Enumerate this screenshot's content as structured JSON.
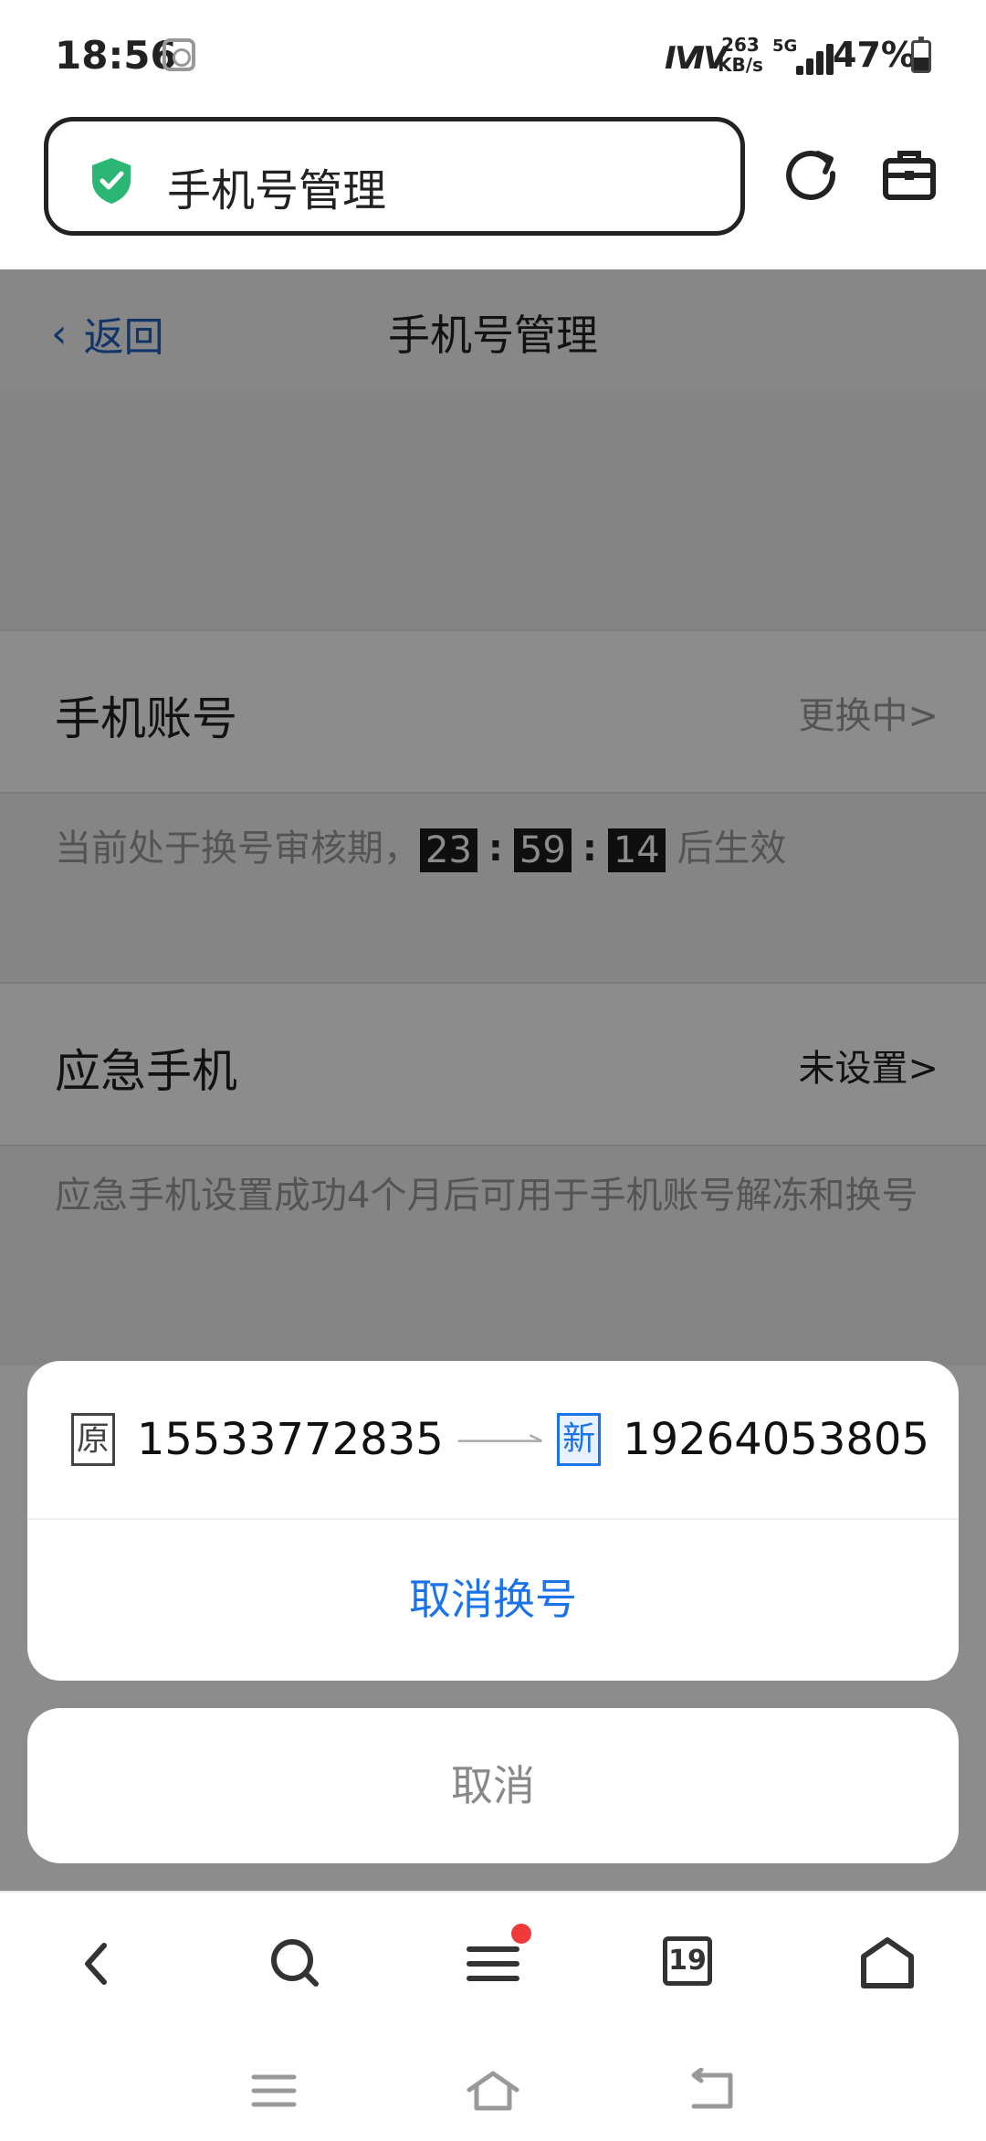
{
  "status_bar": {
    "time": "18:56",
    "nfc_label": "ⅣⅣ",
    "net_speed_value": "263",
    "net_speed_unit": "KB/s",
    "network": "5G",
    "battery_pct": "47%",
    "battery_level": 0.47
  },
  "browser": {
    "address_title": "手机号管理"
  },
  "page": {
    "back_label": "返回",
    "title": "手机号管理",
    "rows": [
      {
        "label": "手机账号",
        "value": "更换中>",
        "value_color": "#999999",
        "desc_prefix": "当前处于换号审核期，",
        "timer": [
          "23",
          "59",
          "14"
        ],
        "desc_suffix": "后生效"
      },
      {
        "label": "应急手机",
        "value": "未设置>",
        "value_color": "#222222",
        "desc": "应急手机设置成功4个月后可用于手机账号解冻和换号"
      }
    ]
  },
  "sheet": {
    "old_tag": "原",
    "old_number": "15533772835",
    "new_tag": "新",
    "new_number": "19264053805",
    "action_label": "取消换号",
    "cancel_label": "取消"
  },
  "toolbar": {
    "tabs_count": "19"
  },
  "colors": {
    "accent": "#1a73e8",
    "link": "#1f5fbf",
    "badge_dot": "#f03a3a",
    "shield": "#2bb673"
  }
}
